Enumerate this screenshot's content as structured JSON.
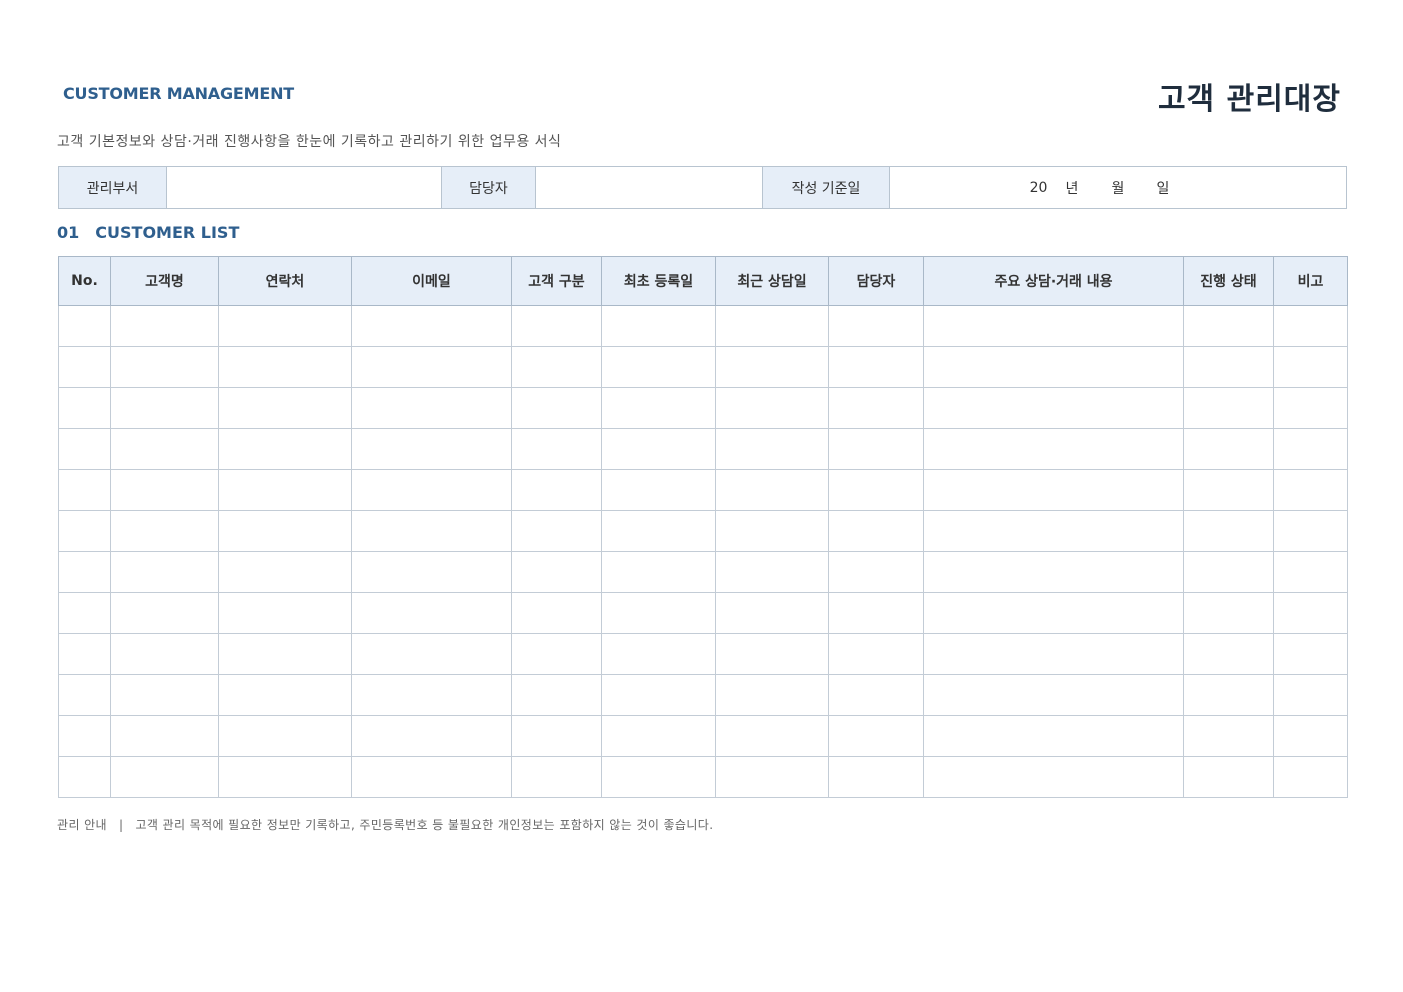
{
  "header": {
    "eyebrow": "CUSTOMER MANAGEMENT",
    "title": "고객 관리대장",
    "subtitle": "고객 기본정보와 상담·거래 진행사항을 한눈에 기록하고 관리하기 위한 업무용 서식"
  },
  "info_bar": {
    "dept_label": "관리부서",
    "dept_value": "",
    "manager_label": "담당자",
    "manager_value": "",
    "date_label": "작성 기준일",
    "date_year_prefix": "20",
    "date_year": "년",
    "date_month": "월",
    "date_day": "일"
  },
  "section": {
    "number": "01",
    "title": "CUSTOMER LIST"
  },
  "table": {
    "columns": [
      "No.",
      "고객명",
      "연락처",
      "이메일",
      "고객 구분",
      "최초 등록일",
      "최근 상담일",
      "담당자",
      "주요 상담·거래 내용",
      "진행 상태",
      "비고"
    ],
    "row_count": 12
  },
  "footnote": {
    "label": "관리 안내",
    "separator": "|",
    "text": "고객 관리 목적에 필요한 정보만 기록하고, 주민등록번호 등 불필요한 개인정보는 포함하지 않는 것이 좋습니다."
  },
  "colors": {
    "accent": "#2f5f8e",
    "header_fill": "#e6eef8",
    "border": "#c3ccd6"
  }
}
